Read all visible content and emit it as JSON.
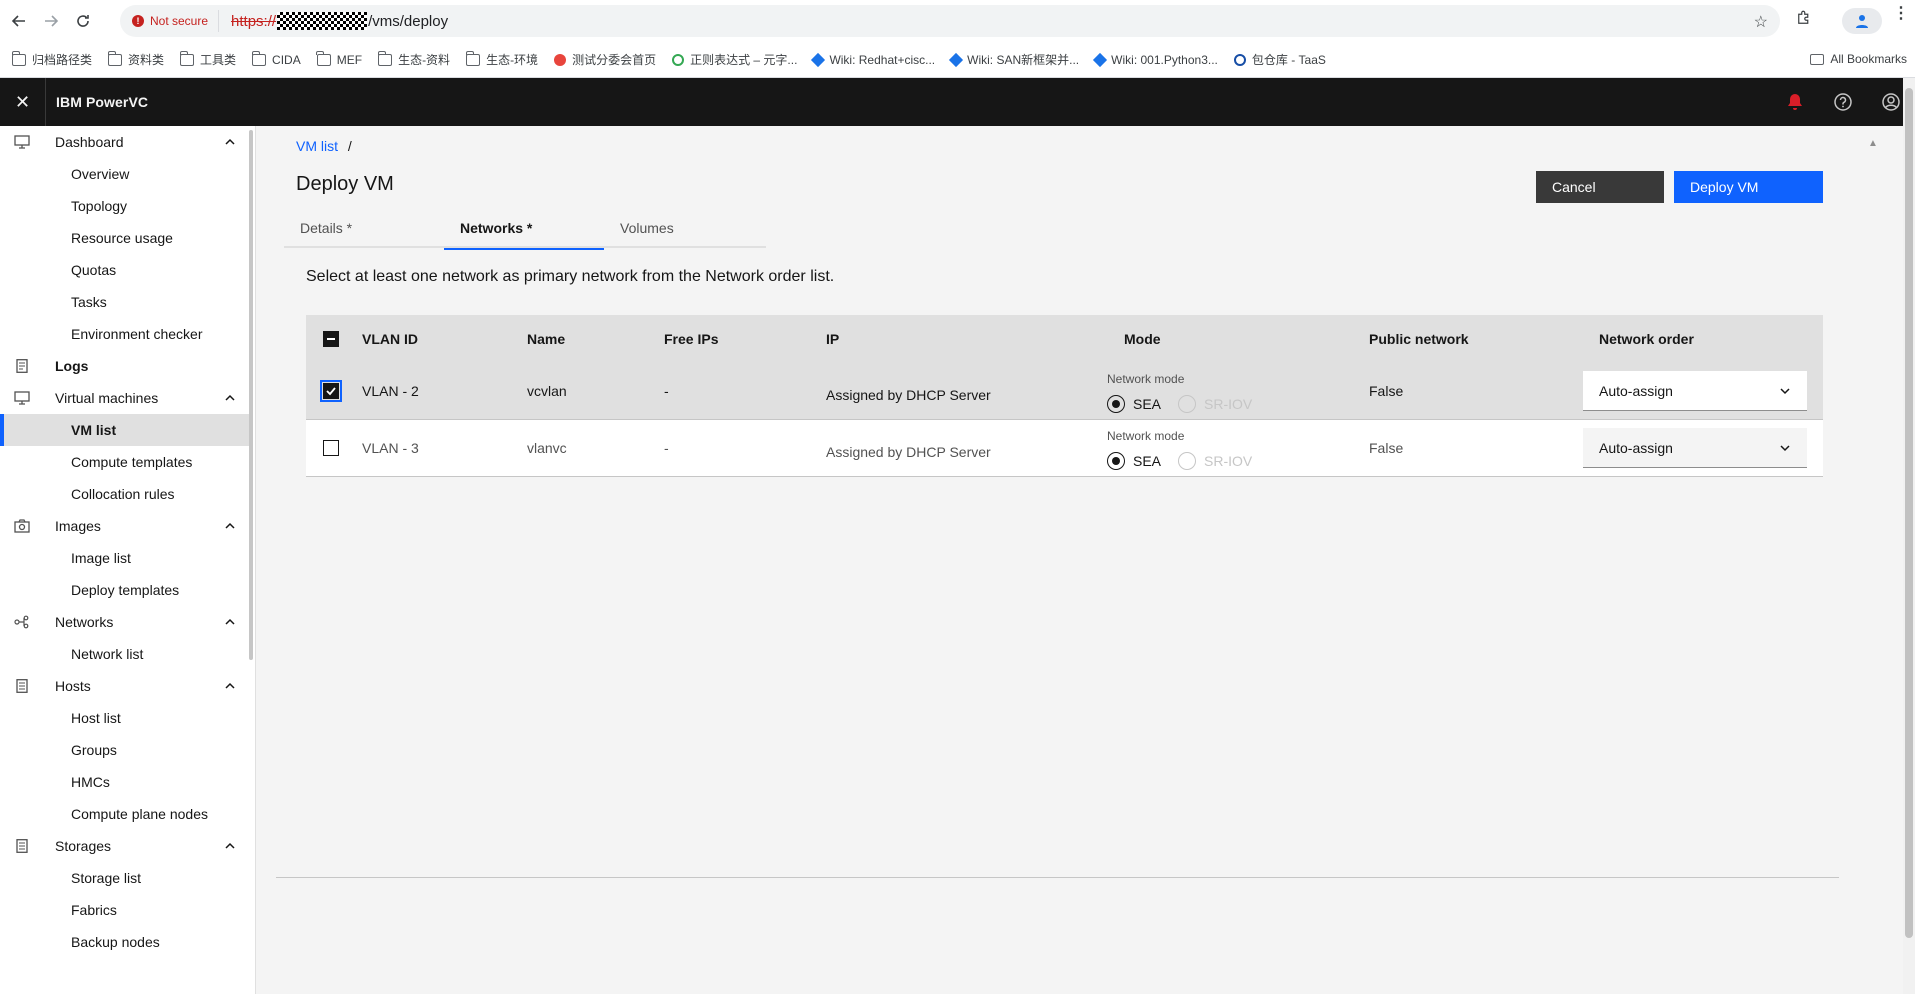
{
  "browser": {
    "security_label": "Not secure",
    "url_scheme": "https://",
    "url_path": "/vms/deploy",
    "bookmarks": [
      {
        "label": "归档路径类",
        "icon": "folder-icon"
      },
      {
        "label": "资料类",
        "icon": "folder-icon"
      },
      {
        "label": "工具类",
        "icon": "folder-icon"
      },
      {
        "label": "CIDA",
        "icon": "folder-icon"
      },
      {
        "label": "MEF",
        "icon": "folder-icon"
      },
      {
        "label": "生态-资料",
        "icon": "folder-icon"
      },
      {
        "label": "生态-环境",
        "icon": "folder-icon"
      },
      {
        "label": "测试分委会首页",
        "icon": "site-icon-red"
      },
      {
        "label": "正则表达式 – 元字...",
        "icon": "site-icon-green"
      },
      {
        "label": "Wiki: Redhat+cisc...",
        "icon": "wiki-icon"
      },
      {
        "label": "Wiki: SAN新框架并...",
        "icon": "wiki-icon"
      },
      {
        "label": "Wiki: 001.Python3...",
        "icon": "wiki-icon"
      },
      {
        "label": "包仓库 - TaaS",
        "icon": "site-icon-blue"
      }
    ],
    "all_bookmarks": "All Bookmarks"
  },
  "app": {
    "title": "IBM PowerVC",
    "accent": "#0f62fe",
    "alert_color": "#da1e28"
  },
  "sidenav": {
    "groups": [
      {
        "label": "Dashboard",
        "icon": "monitor-icon",
        "items": [
          "Overview",
          "Topology",
          "Resource usage",
          "Quotas",
          "Tasks",
          "Environment checker"
        ]
      },
      {
        "label": "Logs",
        "icon": "document-icon",
        "items": []
      },
      {
        "label": "Virtual machines",
        "icon": "monitor-icon",
        "items": [
          "VM list",
          "Compute templates",
          "Collocation rules"
        ]
      },
      {
        "label": "Images",
        "icon": "camera-icon",
        "items": [
          "Image list",
          "Deploy templates"
        ]
      },
      {
        "label": "Networks",
        "icon": "network-icon",
        "items": [
          "Network list"
        ]
      },
      {
        "label": "Hosts",
        "icon": "server-icon",
        "items": [
          "Host list",
          "Groups",
          "HMCs",
          "Compute plane nodes"
        ]
      },
      {
        "label": "Storages",
        "icon": "storage-icon",
        "items": [
          "Storage list",
          "Fabrics",
          "Backup nodes"
        ]
      }
    ],
    "active_item": "VM list"
  },
  "main": {
    "breadcrumb_link": "VM list",
    "breadcrumb_sep": "/",
    "title": "Deploy VM",
    "cancel_label": "Cancel",
    "deploy_label": "Deploy VM",
    "tabs": [
      {
        "label": "Details *",
        "active": false
      },
      {
        "label": "Networks *",
        "active": true
      },
      {
        "label": "Volumes",
        "active": false
      }
    ],
    "instruction": "Select at least one network as primary network from the Network order list.",
    "table": {
      "headers": [
        "VLAN ID",
        "Name",
        "Free IPs",
        "IP",
        "Mode",
        "Public network",
        "Network order"
      ],
      "rows": [
        {
          "checked": true,
          "vlan_id": "VLAN - 2",
          "name": "vcvlan",
          "free_ips": "-",
          "ip": "Assigned by DHCP Server",
          "mode_caption": "Network mode",
          "mode_options": [
            "SEA",
            "SR-IOV"
          ],
          "mode_selected": "SEA",
          "public_network": "False",
          "network_order": "Auto-assign"
        },
        {
          "checked": false,
          "vlan_id": "VLAN - 3",
          "name": "vlanvc",
          "free_ips": "-",
          "ip": "Assigned by DHCP Server",
          "mode_caption": "Network mode",
          "mode_options": [
            "SEA",
            "SR-IOV"
          ],
          "mode_selected": "SEA",
          "public_network": "False",
          "network_order": "Auto-assign"
        }
      ]
    }
  }
}
